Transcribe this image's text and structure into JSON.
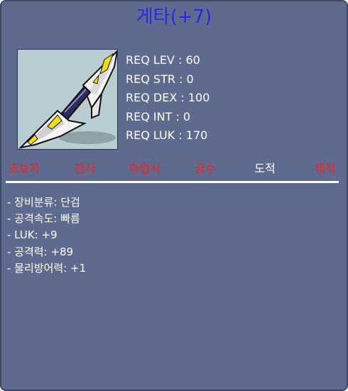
{
  "item": {
    "name": "게타(+7)",
    "image": "dagger-item-icon"
  },
  "requirements": [
    "REQ LEV : 60",
    "REQ STR : 0",
    "REQ DEX : 100",
    "REQ INT : 0",
    "REQ LUK : 170"
  ],
  "jobs": [
    {
      "label": "초보자",
      "color": "#ff1e1e"
    },
    {
      "label": "전사",
      "color": "#ff1e1e"
    },
    {
      "label": "마법사",
      "color": "#ff1e1e"
    },
    {
      "label": "궁수",
      "color": "#ff1e1e"
    },
    {
      "label": "도적",
      "color": "#ffffff"
    },
    {
      "label": "해적",
      "color": "#ff1e1e"
    }
  ],
  "stats": [
    "- 장비분류: 단검",
    "- 공격속도: 빠름",
    "- LUK: +9",
    "- 공격력: +89",
    "- 물리방어력: +1"
  ],
  "colors": {
    "panel_bg": "#5e6a8e",
    "title": "#2a28e6",
    "unavailable_job": "#ff1e1e",
    "available_job": "#ffffff"
  }
}
